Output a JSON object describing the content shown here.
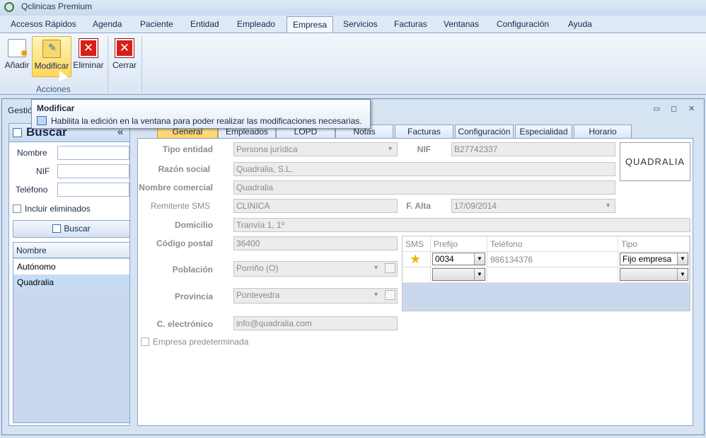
{
  "app": {
    "title": "Qclinicas Premium"
  },
  "menu": [
    "Accesos Rápidos",
    "Agenda",
    "Paciente",
    "Entidad",
    "Empleado",
    "Empresa",
    "Servicios",
    "Facturas",
    "Ventanas",
    "Configuración",
    "Ayuda"
  ],
  "ribbon": {
    "add": "Añadir",
    "modify": "Modificar",
    "delete": "Eliminar",
    "close": "Cerrar",
    "group": "Acciones"
  },
  "tooltip": {
    "title": "Modificar",
    "text": "Habilita la edición en la ventana para poder realizar las modificaciones necesarias."
  },
  "window": {
    "title": "Gestió"
  },
  "search": {
    "title": "Buscar",
    "collapse": "«",
    "name_label": "Nombre",
    "nif_label": "NIF",
    "phone_label": "Teléfono",
    "include_deleted": "Incluir eliminados",
    "button": "Buscar",
    "grid_header": "Nombre",
    "rows": [
      "Autónomo",
      "Quadralia"
    ]
  },
  "tabs": [
    "General",
    "Empleados",
    "LOPD",
    "Notas",
    "Facturas",
    "Configuración",
    "Especialidad",
    "Horario"
  ],
  "form": {
    "tipo_entidad_label": "Tipo entidad",
    "tipo_entidad": "Persona jurídica",
    "nif_label": "NIF",
    "nif": "B27742337",
    "razon_social_label": "Razón social",
    "razon_social": "Quadralia, S.L.",
    "nombre_comercial_label": "Nombre comercial",
    "nombre_comercial": "Quadralia",
    "remitente_label": "Remitente SMS",
    "remitente": "CLINICA",
    "falta_label": "F. Alta",
    "falta": "17/09/2014",
    "domicilio_label": "Domicilio",
    "domicilio": "Tranvía 1, 1º",
    "cp_label": "Código postal",
    "cp": "36400",
    "poblacion_label": "Población",
    "poblacion": "Porriño (O)",
    "provincia_label": "Provincia",
    "provincia": "Pontevedra",
    "email_label": "C. electrónico",
    "email": "info@quadralia.com",
    "empresa_pred": "Empresa predeterminada"
  },
  "logo": {
    "text": "QUADRALIA"
  },
  "phones": {
    "headers": [
      "SMS",
      "Prefijo",
      "Teléfono",
      "Tipo"
    ],
    "rows": [
      {
        "prefijo": "0034",
        "telefono": "986134376",
        "tipo": "Fijo empresa"
      }
    ]
  }
}
